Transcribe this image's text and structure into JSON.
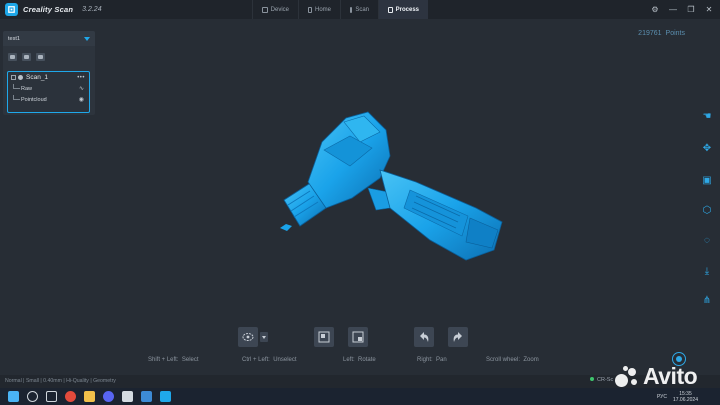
{
  "app": {
    "name": "Creality Scan",
    "version": "3.2.24",
    "accent": "#1fa8ea"
  },
  "tabs": [
    {
      "label": "Device",
      "icon": "device-icon"
    },
    {
      "label": "Home",
      "icon": "home-icon"
    },
    {
      "label": "Scan",
      "icon": "scan-icon"
    },
    {
      "label": "Process",
      "icon": "process-icon",
      "active": true
    }
  ],
  "window_controls": [
    "settings-icon",
    "minimize-icon",
    "maximize-icon",
    "close-icon"
  ],
  "project": {
    "name": "test1",
    "scan": {
      "name": "Scan_1",
      "more": "•••",
      "children": [
        {
          "label": "Raw",
          "icon": "waveform-icon"
        },
        {
          "label": "Pointcloud",
          "icon": "eye-icon"
        }
      ]
    }
  },
  "points": {
    "count": "219761",
    "label": "Points"
  },
  "model": {
    "color": "#1aa3ea",
    "name": "drill-model"
  },
  "bottom_tools": [
    "select-mode-icon",
    "select-all-icon",
    "invert-select-icon",
    "undo-icon",
    "redo-icon"
  ],
  "hints": [
    {
      "keys": "Shift + Left:",
      "action": "Select"
    },
    {
      "keys": "Ctrl + Left:",
      "action": "Unselect"
    },
    {
      "keys": "Left:",
      "action": "Rotate"
    },
    {
      "keys": "Right:",
      "action": "Pan"
    },
    {
      "keys": "Scroll wheel:",
      "action": "Zoom"
    }
  ],
  "status": "Normal | Small | 0.40mm | Hi-Quality | Geometry",
  "device_status": "CR-Sc",
  "right_tools": [
    "hand-touch-icon",
    "move-icon",
    "crop-icon",
    "mesh-icon",
    "texture-icon",
    "export-icon",
    "share-icon"
  ],
  "taskbar": {
    "icons": [
      "windows-icon",
      "search-icon",
      "task-view-icon",
      "chrome-icon",
      "explorer-icon",
      "discord-icon",
      "app-icon",
      "photos-icon",
      "creality-icon"
    ],
    "lang": "РУС",
    "time": "15:35",
    "date": "17.06.2024"
  },
  "watermark": "Avito"
}
